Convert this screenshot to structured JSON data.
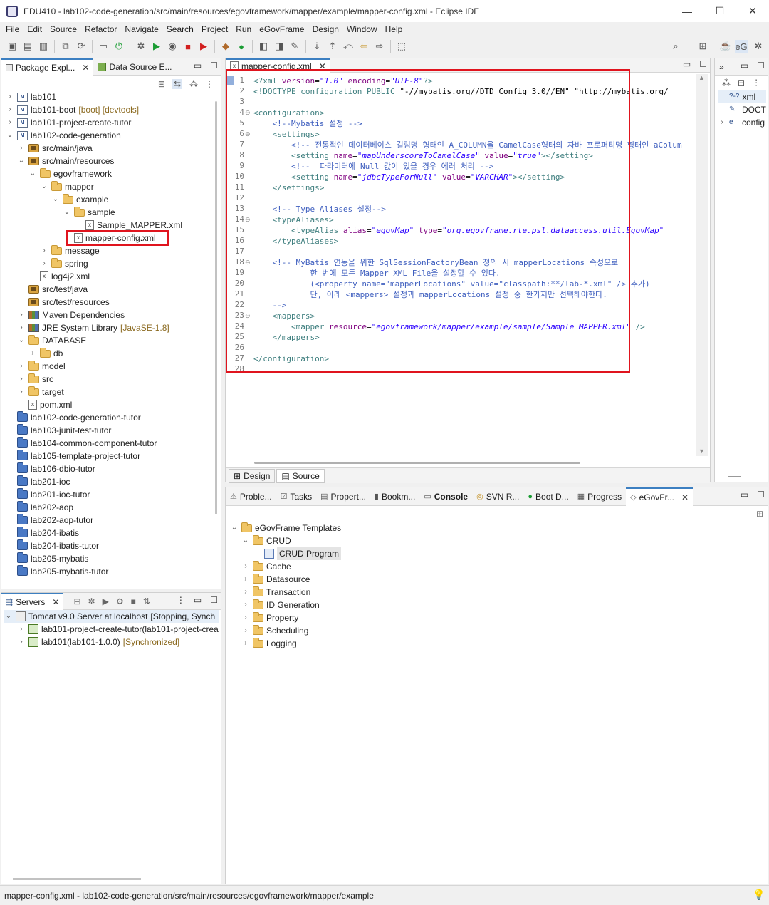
{
  "window": {
    "title": "EDU410 - lab102-code-generation/src/main/resources/egovframework/mapper/example/mapper-config.xml - Eclipse IDE",
    "minimize": "—",
    "maximize": "☐",
    "close": "✕"
  },
  "menu": [
    "File",
    "Edit",
    "Source",
    "Refactor",
    "Navigate",
    "Search",
    "Project",
    "Run",
    "eGovFrame",
    "Design",
    "Window",
    "Help"
  ],
  "explorer": {
    "tabs": [
      {
        "label": "Package Expl...",
        "close": "✕"
      },
      {
        "label": "Data Source E..."
      }
    ],
    "items": [
      {
        "label": "lab101",
        "indent": 0,
        "twisty": "›",
        "icon": "mavproj"
      },
      {
        "label": "lab101-boot",
        "decoration": "[boot] [devtools]",
        "indent": 0,
        "twisty": "›",
        "icon": "mavproj"
      },
      {
        "label": "lab101-project-create-tutor",
        "indent": 0,
        "twisty": "›",
        "icon": "mavproj"
      },
      {
        "label": "lab102-code-generation",
        "indent": 0,
        "twisty": "⌄",
        "icon": "mavproj"
      },
      {
        "label": "src/main/java",
        "indent": 1,
        "twisty": "›",
        "icon": "pkgfolder"
      },
      {
        "label": "src/main/resources",
        "indent": 1,
        "twisty": "⌄",
        "icon": "pkgfolder"
      },
      {
        "label": "egovframework",
        "indent": 2,
        "twisty": "⌄",
        "icon": "folder"
      },
      {
        "label": "mapper",
        "indent": 3,
        "twisty": "⌄",
        "icon": "folder"
      },
      {
        "label": "example",
        "indent": 4,
        "twisty": "⌄",
        "icon": "folder"
      },
      {
        "label": "sample",
        "indent": 5,
        "twisty": "⌄",
        "icon": "folder"
      },
      {
        "label": "Sample_MAPPER.xml",
        "indent": 6,
        "twisty": "",
        "icon": "xmlfile"
      },
      {
        "label": "mapper-config.xml",
        "indent": 5,
        "twisty": "",
        "icon": "xmlfile",
        "highlight": true
      },
      {
        "label": "message",
        "indent": 3,
        "twisty": "›",
        "icon": "folder"
      },
      {
        "label": "spring",
        "indent": 3,
        "twisty": "›",
        "icon": "folder"
      },
      {
        "label": "log4j2.xml",
        "indent": 2,
        "twisty": "",
        "icon": "xmlfile"
      },
      {
        "label": "src/test/java",
        "indent": 1,
        "twisty": "",
        "icon": "pkgfolder"
      },
      {
        "label": "src/test/resources",
        "indent": 1,
        "twisty": "",
        "icon": "pkgfolder"
      },
      {
        "label": "Maven Dependencies",
        "indent": 1,
        "twisty": "›",
        "icon": "lib"
      },
      {
        "label": "JRE System Library",
        "decoration": "[JavaSE-1.8]",
        "indent": 1,
        "twisty": "›",
        "icon": "lib"
      },
      {
        "label": "DATABASE",
        "indent": 1,
        "twisty": "⌄",
        "icon": "folder"
      },
      {
        "label": "db",
        "indent": 2,
        "twisty": "›",
        "icon": "folder"
      },
      {
        "label": "model",
        "indent": 1,
        "twisty": "›",
        "icon": "folder"
      },
      {
        "label": "src",
        "indent": 1,
        "twisty": "›",
        "icon": "folder"
      },
      {
        "label": "target",
        "indent": 1,
        "twisty": "›",
        "icon": "folder"
      },
      {
        "label": "pom.xml",
        "indent": 1,
        "twisty": "",
        "icon": "xmlfile"
      },
      {
        "label": "lab102-code-generation-tutor",
        "indent": 0,
        "twisty": "",
        "icon": "proj"
      },
      {
        "label": "lab103-junit-test-tutor",
        "indent": 0,
        "twisty": "",
        "icon": "proj"
      },
      {
        "label": "lab104-common-component-tutor",
        "indent": 0,
        "twisty": "",
        "icon": "proj"
      },
      {
        "label": "lab105-template-project-tutor",
        "indent": 0,
        "twisty": "",
        "icon": "proj"
      },
      {
        "label": "lab106-dbio-tutor",
        "indent": 0,
        "twisty": "",
        "icon": "proj"
      },
      {
        "label": "lab201-ioc",
        "indent": 0,
        "twisty": "",
        "icon": "proj"
      },
      {
        "label": "lab201-ioc-tutor",
        "indent": 0,
        "twisty": "",
        "icon": "proj"
      },
      {
        "label": "lab202-aop",
        "indent": 0,
        "twisty": "",
        "icon": "proj"
      },
      {
        "label": "lab202-aop-tutor",
        "indent": 0,
        "twisty": "",
        "icon": "proj"
      },
      {
        "label": "lab204-ibatis",
        "indent": 0,
        "twisty": "",
        "icon": "proj"
      },
      {
        "label": "lab204-ibatis-tutor",
        "indent": 0,
        "twisty": "",
        "icon": "proj"
      },
      {
        "label": "lab205-mybatis",
        "indent": 0,
        "twisty": "",
        "icon": "proj"
      },
      {
        "label": "lab205-mybatis-tutor",
        "indent": 0,
        "twisty": "",
        "icon": "proj"
      }
    ]
  },
  "servers": {
    "tab": "Servers",
    "close": "✕",
    "items": [
      {
        "label": "Tomcat v9.0 Server at localhost",
        "decoration": "[Stopping, Synch",
        "indent": 0,
        "twisty": "⌄"
      },
      {
        "label": "lab101-project-create-tutor(lab101-project-crea",
        "decoration": "",
        "indent": 1,
        "twisty": "›"
      },
      {
        "label": "lab101(lab101-1.0.0)",
        "decoration": "[Synchronized]",
        "indent": 1,
        "twisty": "›"
      }
    ]
  },
  "editor": {
    "tab": "mapper-config.xml",
    "close": "✕",
    "bottom_tabs": [
      "Design",
      "Source"
    ],
    "lines": [
      [
        [
          "pi",
          "<?xml "
        ],
        [
          "attr",
          "version"
        ],
        [
          "txt",
          "="
        ],
        [
          "val",
          "\"1.0\""
        ],
        [
          "txt",
          " "
        ],
        [
          "attr",
          "encoding"
        ],
        [
          "txt",
          "="
        ],
        [
          "val",
          "\"UTF-8\""
        ],
        [
          "pi",
          "?>"
        ]
      ],
      [
        [
          "tag",
          "<!DOCTYPE configuration PUBLIC "
        ],
        [
          "txt",
          "\"-//mybatis.org//DTD Config 3.0//EN\" \"http://mybatis.org/"
        ]
      ],
      [],
      [
        [
          "tag",
          "<configuration>"
        ]
      ],
      [
        [
          "txt",
          "    "
        ],
        [
          "cmt",
          "<!--Mybatis 설정 -->"
        ]
      ],
      [
        [
          "txt",
          "    "
        ],
        [
          "tag",
          "<settings>"
        ]
      ],
      [
        [
          "txt",
          "        "
        ],
        [
          "cmt",
          "<!-- 전통적인 데이터베이스 컬럼명 형태인 A_COLUMN을 CamelCase형태의 자바 프로퍼티명 형태인 aColum"
        ]
      ],
      [
        [
          "txt",
          "        "
        ],
        [
          "tag",
          "<setting "
        ],
        [
          "attr",
          "name"
        ],
        [
          "txt",
          "="
        ],
        [
          "val",
          "\"mapUnderscoreToCamelCase\""
        ],
        [
          "txt",
          " "
        ],
        [
          "attr",
          "value"
        ],
        [
          "txt",
          "="
        ],
        [
          "val",
          "\"true\""
        ],
        [
          "tag",
          "></setting>"
        ]
      ],
      [
        [
          "txt",
          "        "
        ],
        [
          "cmt",
          "<!--  파라미터에 Null 값이 있을 경우 에러 처리 -->"
        ]
      ],
      [
        [
          "txt",
          "        "
        ],
        [
          "tag",
          "<setting "
        ],
        [
          "attr",
          "name"
        ],
        [
          "txt",
          "="
        ],
        [
          "val",
          "\"jdbcTypeForNull\""
        ],
        [
          "txt",
          " "
        ],
        [
          "attr",
          "value"
        ],
        [
          "txt",
          "="
        ],
        [
          "val",
          "\"VARCHAR\""
        ],
        [
          "tag",
          "></setting>"
        ]
      ],
      [
        [
          "txt",
          "    "
        ],
        [
          "tag",
          "</settings>"
        ]
      ],
      [],
      [
        [
          "txt",
          "    "
        ],
        [
          "cmt",
          "<!-- Type Aliases 설정-->"
        ]
      ],
      [
        [
          "txt",
          "    "
        ],
        [
          "tag",
          "<typeAliases>"
        ]
      ],
      [
        [
          "txt",
          "        "
        ],
        [
          "tag",
          "<typeAlias "
        ],
        [
          "attr",
          "alias"
        ],
        [
          "txt",
          "="
        ],
        [
          "val",
          "\"egovMap\""
        ],
        [
          "txt",
          " "
        ],
        [
          "attr",
          "type"
        ],
        [
          "txt",
          "="
        ],
        [
          "val",
          "\"org.egovframe.rte.psl.dataaccess.util.EgovMap\""
        ]
      ],
      [
        [
          "txt",
          "    "
        ],
        [
          "tag",
          "</typeAliases>"
        ]
      ],
      [],
      [
        [
          "txt",
          "    "
        ],
        [
          "cmt",
          "<!-- MyBatis 연동을 위한 SqlSessionFactoryBean 정의 시 mapperLocations 속성으로"
        ]
      ],
      [
        [
          "cmt",
          "            한 번에 모든 Mapper XML File을 설정할 수 있다."
        ]
      ],
      [
        [
          "cmt",
          "            (<property name=\"mapperLocations\" value=\"classpath:**/lab-*.xml\" /> 추가)"
        ]
      ],
      [
        [
          "cmt",
          "            단, 아래 <mappers> 설정과 mapperLocations 설정 중 한가지만 선택해야한다."
        ]
      ],
      [
        [
          "cmt",
          "    -->"
        ]
      ],
      [
        [
          "txt",
          "    "
        ],
        [
          "tag",
          "<mappers>"
        ]
      ],
      [
        [
          "txt",
          "        "
        ],
        [
          "tag",
          "<mapper "
        ],
        [
          "attr",
          "resource"
        ],
        [
          "txt",
          "="
        ],
        [
          "val",
          "\"egovframework/mapper/example/sample/Sample_MAPPER.xml\""
        ],
        [
          "txt",
          " "
        ],
        [
          "tag",
          "/>"
        ]
      ],
      [
        [
          "txt",
          "    "
        ],
        [
          "tag",
          "</mappers>"
        ]
      ],
      [],
      [
        [
          "tag",
          "</configuration>"
        ]
      ],
      []
    ],
    "line_numbers": [
      "1",
      "2",
      "3",
      "4",
      "5",
      "6",
      "7",
      "8",
      "9",
      "10",
      "11",
      "12",
      "13",
      "14",
      "15",
      "16",
      "17",
      "18",
      "19",
      "20",
      "21",
      "22",
      "23",
      "24",
      "25",
      "26",
      "27",
      "28"
    ],
    "fold_markers": [
      "4",
      "6",
      "14",
      "18",
      "23"
    ]
  },
  "outline": {
    "items": [
      {
        "label": "xml",
        "icon": "?-?",
        "twisty": ""
      },
      {
        "label": "DOCT",
        "icon": "✎",
        "twisty": ""
      },
      {
        "label": "config",
        "icon": "e",
        "twisty": "›"
      }
    ]
  },
  "bottom_panel": {
    "tabs": [
      "Proble...",
      "Tasks",
      "Propert...",
      "Bookm...",
      "Console",
      "SVN R...",
      "Boot D...",
      "Progress",
      "eGovFr..."
    ],
    "active_tab": "eGovFr...",
    "close": "✕",
    "tree": [
      {
        "label": "eGovFrame Templates",
        "indent": 0,
        "twisty": "⌄",
        "icon": "folder"
      },
      {
        "label": "CRUD",
        "indent": 1,
        "twisty": "⌄",
        "icon": "folder"
      },
      {
        "label": "CRUD Program",
        "indent": 2,
        "twisty": "",
        "icon": "program",
        "selected": true
      },
      {
        "label": "Cache",
        "indent": 1,
        "twisty": "›",
        "icon": "folder"
      },
      {
        "label": "Datasource",
        "indent": 1,
        "twisty": "›",
        "icon": "folder"
      },
      {
        "label": "Transaction",
        "indent": 1,
        "twisty": "›",
        "icon": "folder"
      },
      {
        "label": "ID Generation",
        "indent": 1,
        "twisty": "›",
        "icon": "folder"
      },
      {
        "label": "Property",
        "indent": 1,
        "twisty": "›",
        "icon": "folder"
      },
      {
        "label": "Scheduling",
        "indent": 1,
        "twisty": "›",
        "icon": "folder"
      },
      {
        "label": "Logging",
        "indent": 1,
        "twisty": "›",
        "icon": "folder"
      }
    ]
  },
  "status": {
    "path": "mapper-config.xml - lab102-code-generation/src/main/resources/egovframework/mapper/example"
  },
  "colors": {
    "highlight_box": "#e0141e",
    "active_tab": "#3c7fc1"
  }
}
